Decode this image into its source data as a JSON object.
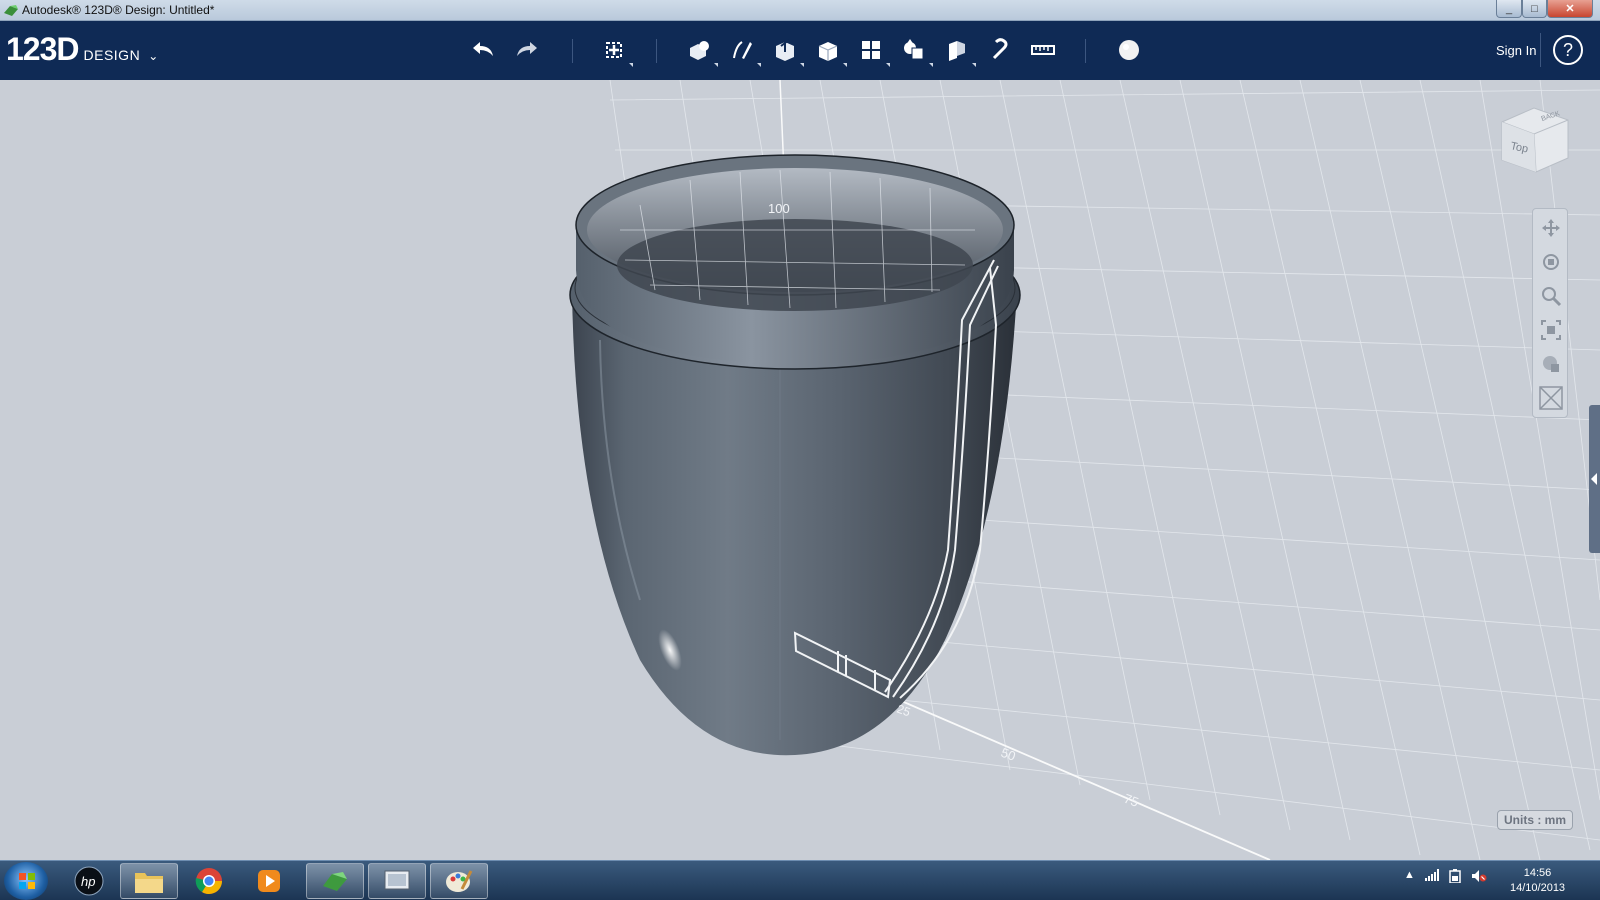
{
  "window": {
    "title": "Autodesk® 123D® Design: Untitled*",
    "minimize": "_",
    "maximize": "□",
    "close": "✕"
  },
  "toolbar": {
    "logo_main": "123D",
    "logo_sub": "DESIGN",
    "logo_chevron": "⌄",
    "sign_in": "Sign In",
    "help": "?",
    "tools": [
      "undo-icon",
      "redo-icon",
      "transform-icon",
      "primitives-icon",
      "sketch-icon",
      "construct-icon",
      "modify-icon",
      "pattern-icon",
      "grouping-icon",
      "combine-icon",
      "snap-icon",
      "measure-icon",
      "material-icon"
    ]
  },
  "viewport": {
    "grid_labels": [
      "100",
      "25",
      "50",
      "75"
    ],
    "viewcube_face": "Top",
    "viewcube_side": "BACK",
    "units_label": "Units : mm",
    "nav_tools": [
      "pan-icon",
      "orbit-icon",
      "zoom-icon",
      "fit-icon",
      "view-icon",
      "visibility-icon"
    ]
  },
  "taskbar": {
    "apps": [
      "hp-icon",
      "explorer-icon",
      "chrome-icon",
      "media-player-icon",
      "123d-app-icon",
      "video-icon",
      "paint-icon"
    ],
    "time": "14:56",
    "date": "14/10/2013",
    "tray_arrow": "▲"
  }
}
